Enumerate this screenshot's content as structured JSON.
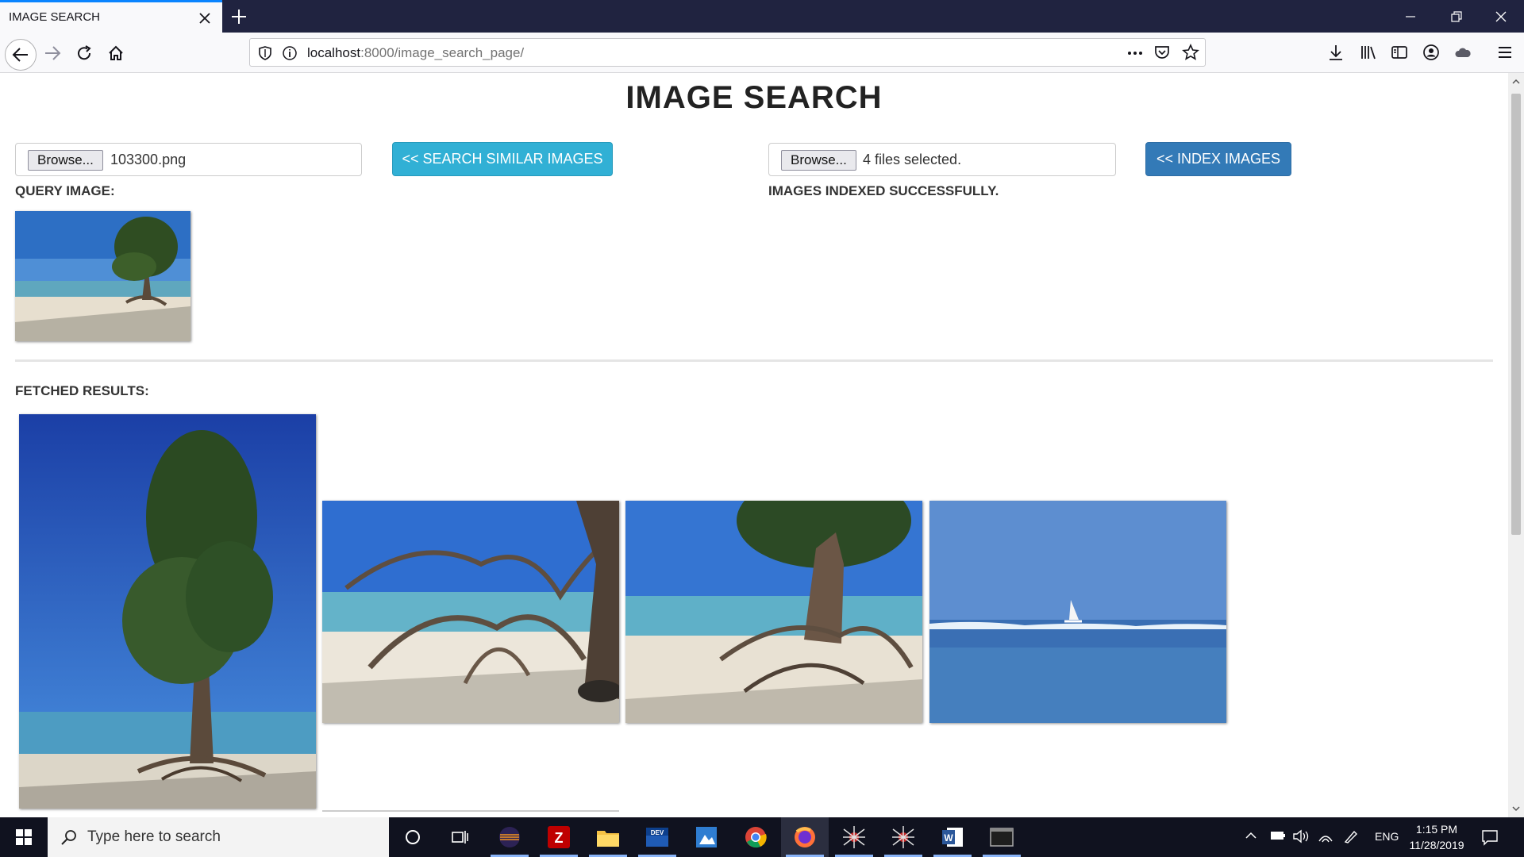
{
  "browser": {
    "tab_title": "IMAGE SEARCH",
    "url_host": "localhost",
    "url_rest": ":8000/image_search_page/"
  },
  "page": {
    "title": "IMAGE SEARCH",
    "query_input": {
      "browse_label": "Browse...",
      "file_name": "103300.png"
    },
    "search_button": "<< SEARCH SIMILAR IMAGES",
    "index_input": {
      "browse_label": "Browse...",
      "file_name": "4 files selected."
    },
    "index_button": "<< INDEX IMAGES",
    "query_label": "QUERY IMAGE:",
    "index_status": "IMAGES INDEXED SUCCESSFULLY.",
    "results_label": "FETCHED RESULTS:"
  },
  "taskbar": {
    "search_placeholder": "Type here to search",
    "language": "ENG",
    "time": "1:15 PM",
    "date": "11/28/2019"
  },
  "colors": {
    "accent_info": "#31b0d5",
    "accent_primary": "#337ab7",
    "titlebar": "#202340"
  }
}
